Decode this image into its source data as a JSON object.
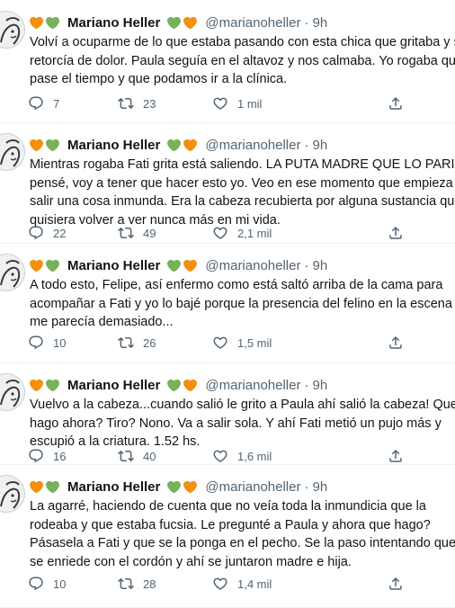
{
  "tweets": [
    {
      "name": "Mariano Heller",
      "handle": "@marianoheller",
      "sep": "·",
      "time": "9h",
      "lines": [
        "Volví a ocuparme de lo que estaba pasando con esta chica que gritaba y se",
        "retorcía de dolor. Paula seguía en el altavoz y nos calmaba. Yo rogaba que",
        "pase el tiempo y que podamos ir a la clínica."
      ],
      "replies": "7",
      "retweets": "23",
      "likes": "1 mil"
    },
    {
      "name": "Mariano Heller",
      "handle": "@marianoheller",
      "sep": "·",
      "time": "9h",
      "lines": [
        "Mientras rogaba Fati grita está saliendo. LA PUTA MADRE QUE LO PARIÓ,",
        "pensé, voy a tener que hacer esto yo. Veo en ese momento que empieza a",
        "salir una cosa inmunda. Era la cabeza recubierta por alguna sustancia que no",
        "quisiera volver a ver nunca más en mi vida."
      ],
      "replies": "22",
      "retweets": "49",
      "likes": "2,1 mil"
    },
    {
      "name": "Mariano Heller",
      "handle": "@marianoheller",
      "sep": "·",
      "time": "9h",
      "lines": [
        "A todo esto, Felipe, así enfermo como está saltó arriba de la cama para",
        "acompañar a Fati y yo lo bajé porque la presencia del felino en la escena ya",
        "me parecía demasiado..."
      ],
      "replies": "10",
      "retweets": "26",
      "likes": "1,5 mil"
    },
    {
      "name": "Mariano Heller",
      "handle": "@marianoheller",
      "sep": "·",
      "time": "9h",
      "lines": [
        "Vuelvo a la cabeza...cuando salió le grito a Paula ahí salió la cabeza! Que",
        "hago ahora? Tiro? Nono. Va a salir sola. Y ahí Fati metió un pujo más y",
        "escupió a la criatura. 1.52 hs."
      ],
      "replies": "16",
      "retweets": "40",
      "likes": "1,6 mil"
    },
    {
      "name": "Mariano Heller",
      "handle": "@marianoheller",
      "sep": "·",
      "time": "9h",
      "lines": [
        "La agarré, haciendo de cuenta que no veía toda la inmundicia que la",
        "rodeaba y que estaba fucsia. Le pregunté a Paula y ahora que hago?",
        "Pásasela a Fati y que se la ponga en el pecho. Se la paso intentando que no",
        "se enriede con el cordón y ahí se juntaron madre e hija."
      ],
      "replies": "10",
      "retweets": "28",
      "likes": "1,4 mil"
    }
  ],
  "colors": {
    "orange_heart": "#f4900c",
    "green_heart": "#78b159",
    "meta_text": "#536471",
    "main_text": "#0f1419"
  },
  "icons": {
    "reply": "reply-icon",
    "retweet": "retweet-icon",
    "like": "heart-icon",
    "share": "share-icon",
    "orange": "orange-heart-icon",
    "green": "green-heart-icon"
  }
}
